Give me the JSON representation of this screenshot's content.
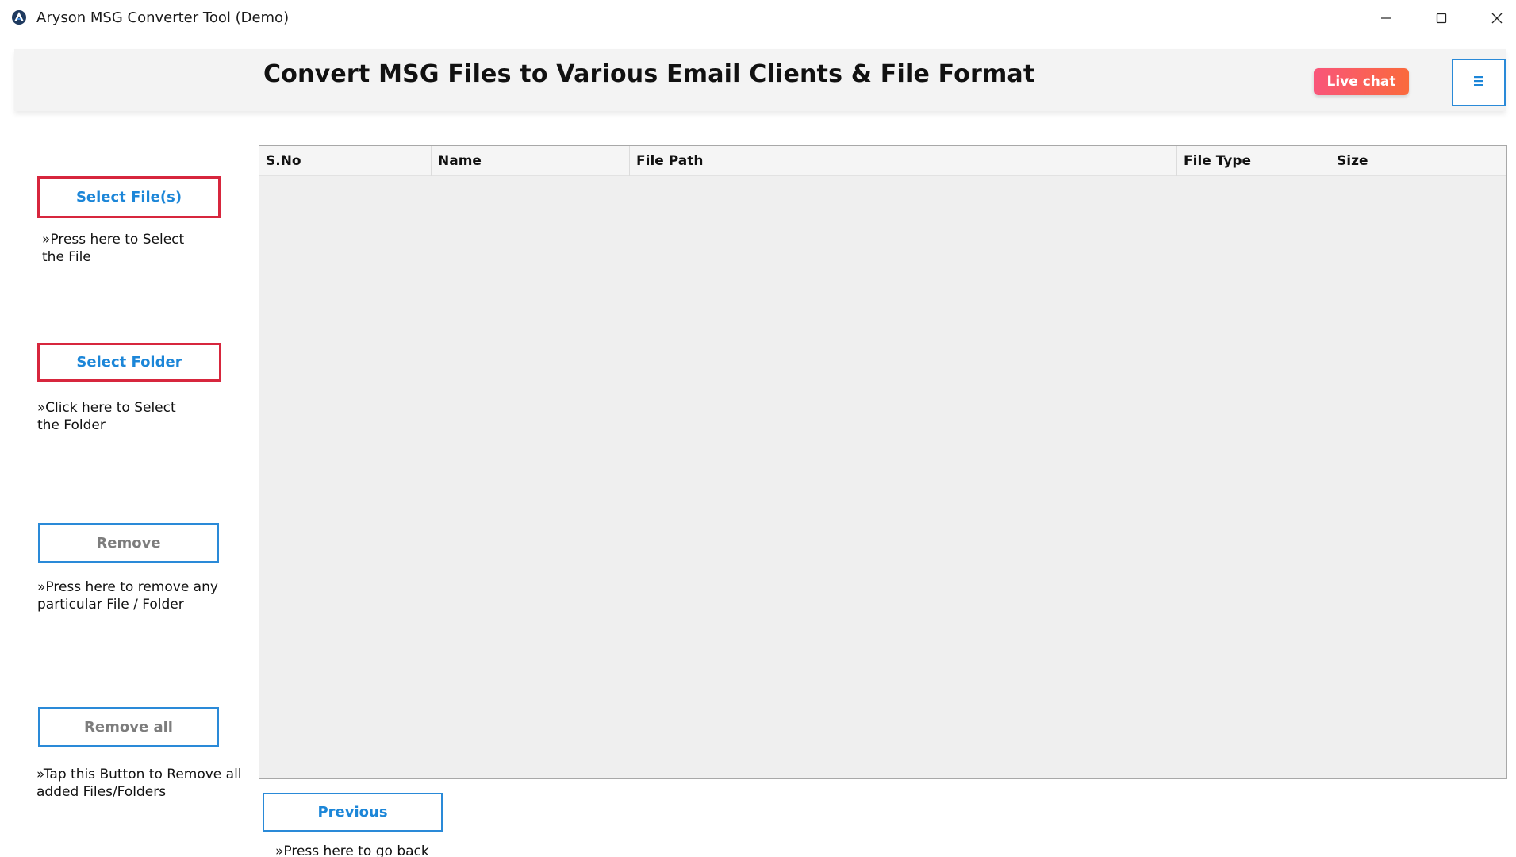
{
  "window": {
    "title": "Aryson MSG Converter Tool (Demo)",
    "icon": "aryson-logo-icon",
    "controls": [
      "minimize-icon",
      "maximize-icon",
      "close-icon"
    ]
  },
  "header": {
    "title": "Convert MSG Files to Various Email Clients & File Format",
    "live_chat_label": "Live chat",
    "menu_icon": "hamburger-menu-icon"
  },
  "sidebar": {
    "select_files": {
      "label": "Select File(s)",
      "hint": "»Press here to Select the File"
    },
    "select_folder": {
      "label": "Select Folder",
      "hint": "»Click here to Select the Folder"
    },
    "remove": {
      "label": "Remove",
      "hint": "»Press here to remove any particular File / Folder"
    },
    "remove_all": {
      "label": "Remove all",
      "hint": "»Tap this Button to Remove all added Files/Folders"
    }
  },
  "table": {
    "columns": [
      "S.No",
      "Name",
      "File Path",
      "File Type",
      "Size"
    ],
    "rows": []
  },
  "footer": {
    "previous_label": "Previous",
    "previous_hint": "»Press here to go back"
  },
  "colors": {
    "accent_blue": "#1c86d8",
    "border_red": "#d7263d",
    "live_chat_start": "#f9557a",
    "live_chat_end": "#fa6a3c"
  }
}
